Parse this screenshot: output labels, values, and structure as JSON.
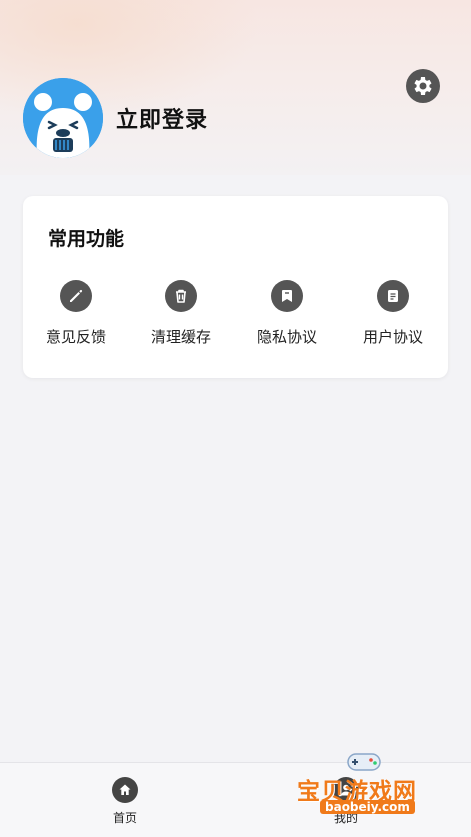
{
  "header": {
    "login_label": "立即登录"
  },
  "card": {
    "title": "常用功能",
    "items": [
      {
        "label": "意见反馈",
        "icon": "pencil-icon"
      },
      {
        "label": "清理缓存",
        "icon": "trash-icon"
      },
      {
        "label": "隐私协议",
        "icon": "bookmark-icon"
      },
      {
        "label": "用户协议",
        "icon": "document-icon"
      }
    ]
  },
  "bottom_nav": {
    "tabs": [
      {
        "label": "首页",
        "icon": "home-icon"
      },
      {
        "label": "我的",
        "icon": "user-icon"
      }
    ]
  },
  "watermark": {
    "text": "宝贝游戏网",
    "url": "baobeiy.com"
  },
  "colors": {
    "icon_bg": "#555555",
    "avatar_bg": "#3aa0ea",
    "watermark": "#f07a1a"
  }
}
